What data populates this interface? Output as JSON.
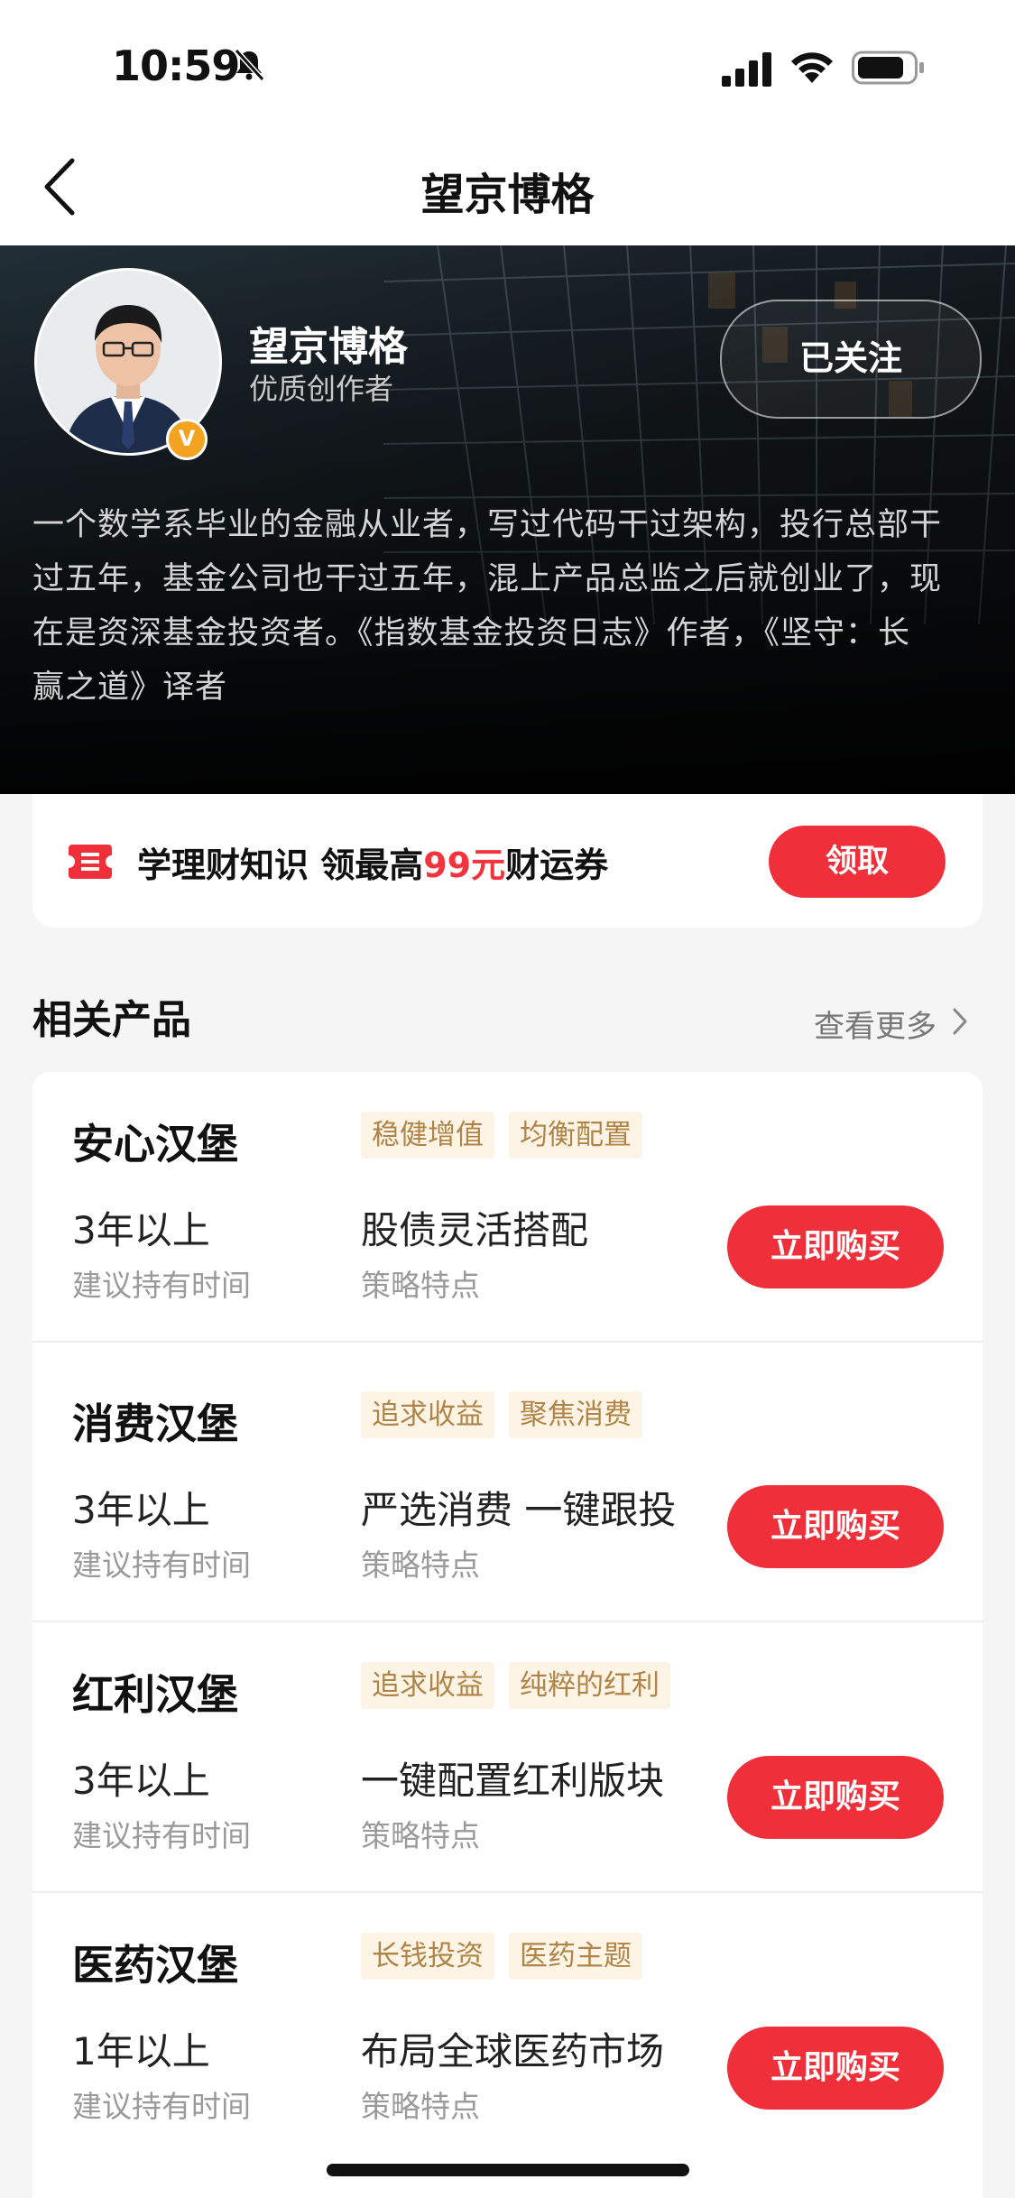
{
  "status_bar": {
    "time": "10:59"
  },
  "nav": {
    "title": "望京博格"
  },
  "profile": {
    "name": "望京博格",
    "subtitle": "优质创作者",
    "badge": "V",
    "follow_label": "已关注",
    "bio_lines": [
      "一个数学系毕业的金融从业者，写过代码干过架构，投行总部干",
      "过五年，基金公司也干过五年，混上产品总监之后就创业了，现",
      "在是资深基金投资者。《指数基金投资日志》作者，《坚守：长",
      "赢之道》译者"
    ]
  },
  "coupon": {
    "text_before": "学理财知识  领最高",
    "amount": "99元",
    "text_after": "财运券",
    "button": "领取"
  },
  "section": {
    "title": "相关产品",
    "more": "查看更多"
  },
  "products": [
    {
      "name": "安心汉堡",
      "tags": [
        "稳健增值",
        "均衡配置"
      ],
      "hold_value": "3年以上",
      "hold_label": "建议持有时间",
      "strategy_value": "股债灵活搭配",
      "strategy_label": "策略特点",
      "buy": "立即购买"
    },
    {
      "name": "消费汉堡",
      "tags": [
        "追求收益",
        "聚焦消费"
      ],
      "hold_value": "3年以上",
      "hold_label": "建议持有时间",
      "strategy_value": "严选消费 一键跟投",
      "strategy_label": "策略特点",
      "buy": "立即购买"
    },
    {
      "name": "红利汉堡",
      "tags": [
        "追求收益",
        "纯粹的红利"
      ],
      "hold_value": "3年以上",
      "hold_label": "建议持有时间",
      "strategy_value": "一键配置红利版块",
      "strategy_label": "策略特点",
      "buy": "立即购买"
    },
    {
      "name": "医药汉堡",
      "tags": [
        "长钱投资",
        "医药主题"
      ],
      "hold_value": "1年以上",
      "hold_label": "建议持有时间",
      "strategy_value": "布局全球医药市场",
      "strategy_label": "策略特点",
      "buy": "立即购买"
    }
  ],
  "colors": {
    "accent_red": "#ef2f3a",
    "tag_bg": "#fdf4e6",
    "tag_text": "#b08447",
    "badge_orange": "#f3a31f"
  },
  "icons": [
    "bell-slash-icon",
    "cellular-signal-icon",
    "wifi-icon",
    "battery-icon",
    "back-chevron-icon",
    "coupon-ticket-icon",
    "chevron-right-icon"
  ]
}
